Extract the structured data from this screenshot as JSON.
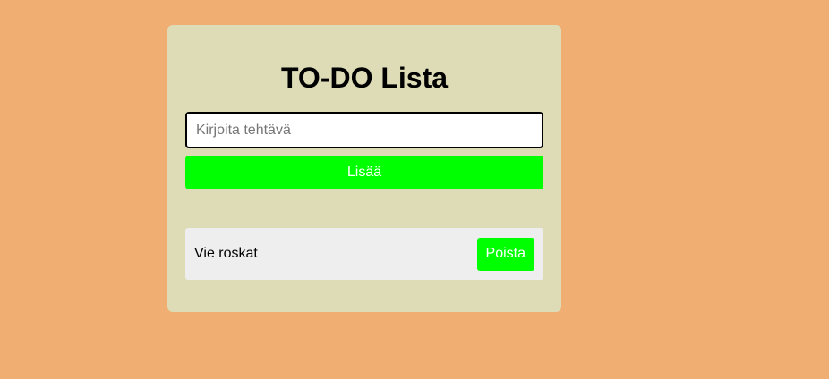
{
  "app": {
    "title": "TO-DO Lista"
  },
  "input": {
    "placeholder": "Kirjoita tehtävä",
    "value": ""
  },
  "add_button": {
    "label": "Lisää"
  },
  "tasks": [
    {
      "text": "Vie roskat",
      "delete_label": "Poista"
    }
  ],
  "colors": {
    "background": "#f0ae72",
    "card": "#dedcb7",
    "accent": "#00ff00",
    "task_bg": "#eeeeee"
  }
}
